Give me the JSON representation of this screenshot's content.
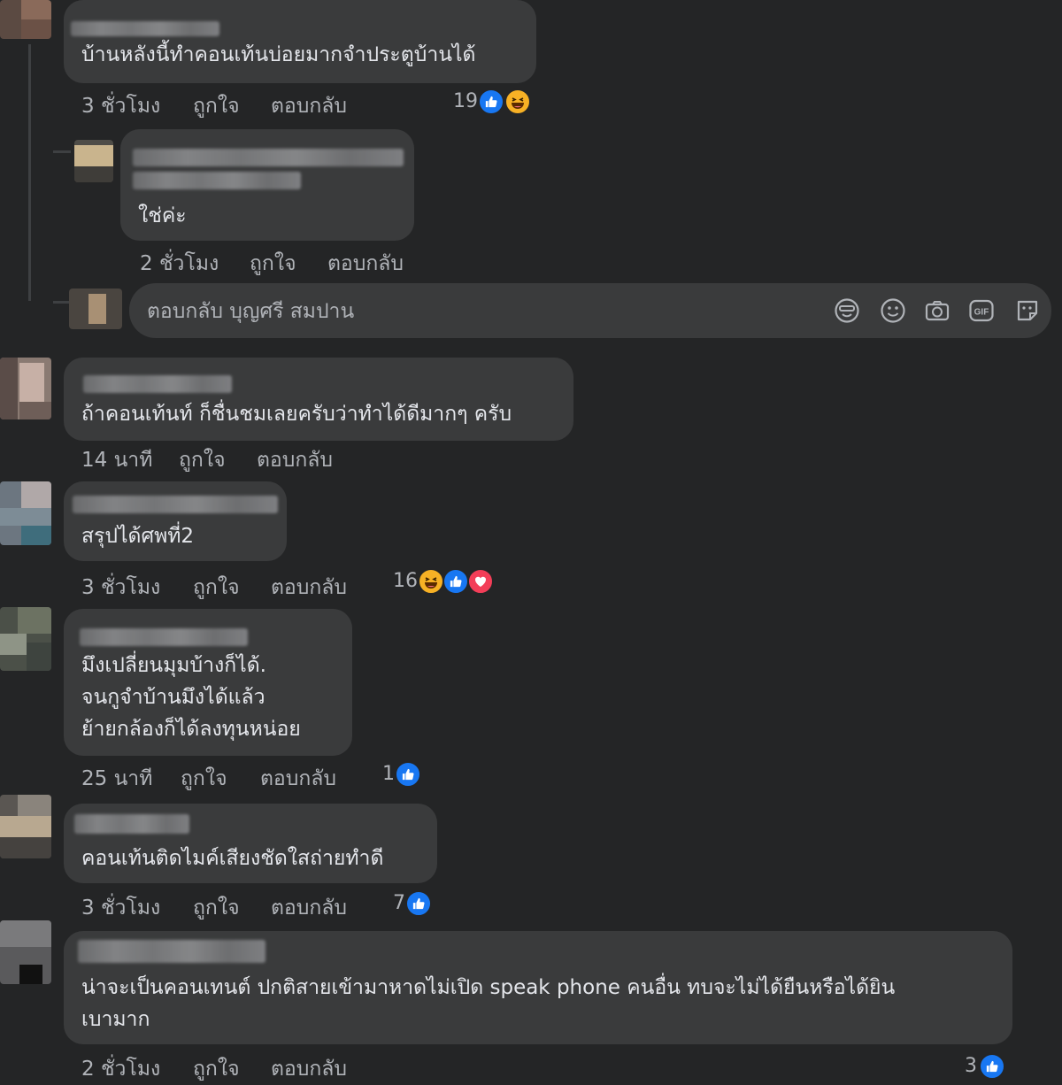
{
  "colors": {
    "background": "#242526",
    "bubble": "#3a3b3c",
    "text": "#e4e6eb",
    "meta": "#b0b3b8",
    "like": "#1877f2",
    "love": "#f33e58",
    "haha": "#f7b125"
  },
  "comments": [
    {
      "lines": [
        "บ้านหลังนี้ทำคอนเท้นบ่อยมากจำประตูบ้านได้"
      ],
      "time": "3 ชั่วโมง",
      "like": "ถูกใจ",
      "reply": "ตอบกลับ",
      "reaction_count": "19",
      "reactions": [
        "like-icon",
        "haha-icon"
      ]
    },
    {
      "lines": [
        "ใช่ค่ะ"
      ],
      "time": "2 ชั่วโมง",
      "like": "ถูกใจ",
      "reply": "ตอบกลับ",
      "reaction_count": "",
      "reactions": []
    },
    {
      "lines": [
        "ถ้าคอนเท้นท์ ก็ชื่นชมเลยครับว่าทำได้ดีมากๆ ครับ"
      ],
      "time": "14 นาที",
      "like": "ถูกใจ",
      "reply": "ตอบกลับ",
      "reaction_count": "",
      "reactions": []
    },
    {
      "lines": [
        "สรุปได้ศพที่2"
      ],
      "time": "3 ชั่วโมง",
      "like": "ถูกใจ",
      "reply": "ตอบกลับ",
      "reaction_count": "16",
      "reactions": [
        "haha-icon",
        "like-icon",
        "love-icon"
      ]
    },
    {
      "lines": [
        "มึงเปลี่ยนมุมบ้างก็ได้.",
        "จนกูจำบ้านมึงได้แล้ว",
        "ย้ายกล้องก็ได้ลงทุนหน่อย"
      ],
      "time": "25 นาที",
      "like": "ถูกใจ",
      "reply": "ตอบกลับ",
      "reaction_count": "1",
      "reactions": [
        "like-icon"
      ]
    },
    {
      "lines": [
        "คอนเท้นติดไมค์เสียงชัดใสถ่ายทำดี"
      ],
      "time": "3 ชั่วโมง",
      "like": "ถูกใจ",
      "reply": "ตอบกลับ",
      "reaction_count": "7",
      "reactions": [
        "like-icon"
      ]
    },
    {
      "lines": [
        "น่าจะเป็นคอนเทนต์ ปกติสายเข้ามาหาดไม่เปิด speak phone คนอื่น ทบจะไม่ได้ยืนหรือได้ยิน",
        "เบามาก"
      ],
      "time": "2 ชั่วโมง",
      "like": "ถูกใจ",
      "reply": "ตอบกลับ",
      "reaction_count": "3",
      "reactions": [
        "like-icon"
      ]
    }
  ],
  "reply_box": {
    "placeholder": "ตอบกลับ บุญศรี สมปาน",
    "tools": [
      "sticker-icon",
      "emoji-icon",
      "camera-icon",
      "gif-icon",
      "avatar-sticker-icon"
    ],
    "gif_label": "GIF"
  }
}
